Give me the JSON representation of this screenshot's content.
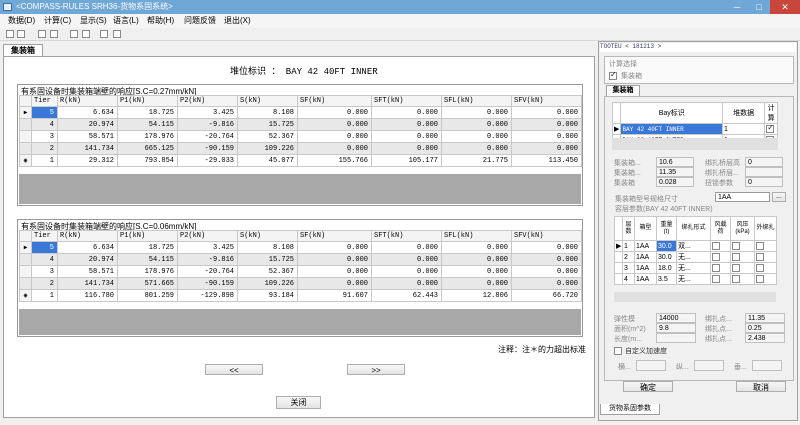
{
  "window": {
    "title": "<COMPASS-RULES SRH36-货物系固系统>"
  },
  "menu": [
    "数据(D)",
    "计算(C)",
    "显示(S)",
    "语言(L)",
    "帮助(H)",
    "问题反馈",
    "退出(X)"
  ],
  "tab_label": "集装箱",
  "stack_id": "堆位标识 ： BAY 42 40FT INNER",
  "grid1": {
    "caption": "有系固设备时集装箱端壁的响应[S.C=0.27mm/kN]",
    "headers": [
      "",
      "Tier",
      "R(kN)",
      "P1(kN)",
      "P2(kN)",
      "S(kN)",
      "SF(kN)",
      "SFT(kN)",
      "SFL(kN)",
      "SFV(kN)"
    ],
    "rows": [
      {
        "ind": "▶",
        "cells": [
          "5",
          "6.634",
          "18.725",
          "3.425",
          "8.108",
          "0.000",
          "0.000",
          "0.000",
          "0.000"
        ]
      },
      {
        "ind": "",
        "cells": [
          "4",
          "20.974",
          "54.115",
          "-9.816",
          "15.725",
          "0.000",
          "0.000",
          "0.000",
          "0.000"
        ]
      },
      {
        "ind": "",
        "cells": [
          "3",
          "58.571",
          "178.976",
          "-20.764",
          "52.367",
          "0.000",
          "0.000",
          "0.000",
          "0.000"
        ]
      },
      {
        "ind": "",
        "cells": [
          "2",
          "141.734",
          "665.125",
          "-90.159",
          "109.226",
          "0.000",
          "0.000",
          "0.000",
          "0.000"
        ]
      },
      {
        "ind": "◉",
        "cells": [
          "1",
          "29.312",
          "793.854",
          "-29.033",
          "45.077",
          "155.766",
          "105.177",
          "21.775",
          "113.450"
        ]
      }
    ]
  },
  "grid2": {
    "caption": "有系固设备时集装箱端壁的响应[S.C=0.06mm/kN]",
    "headers": [
      "",
      "Tier",
      "R(kN)",
      "P1(kN)",
      "P2(kN)",
      "S(kN)",
      "SF(kN)",
      "SFT(kN)",
      "SFL(kN)",
      "SFV(kN)"
    ],
    "rows": [
      {
        "ind": "▶",
        "cells": [
          "5",
          "6.634",
          "18.725",
          "3.425",
          "8.108",
          "0.000",
          "0.000",
          "0.000",
          "0.000"
        ]
      },
      {
        "ind": "",
        "cells": [
          "4",
          "20.974",
          "54.115",
          "-9.816",
          "15.725",
          "0.000",
          "0.000",
          "0.000",
          "0.000"
        ]
      },
      {
        "ind": "",
        "cells": [
          "3",
          "58.571",
          "178.976",
          "-20.764",
          "52.367",
          "0.000",
          "0.000",
          "0.000",
          "0.000"
        ]
      },
      {
        "ind": "",
        "cells": [
          "2",
          "141.734",
          "571.665",
          "-90.159",
          "109.226",
          "0.000",
          "0.000",
          "0.000",
          "0.000"
        ]
      },
      {
        "ind": "◉",
        "cells": [
          "1",
          "116.780",
          "801.259",
          "-129.898",
          "93.184",
          "91.607",
          "62.443",
          "12.806",
          "66.720"
        ]
      }
    ]
  },
  "note": "注释：注＊的力超出标准",
  "nav": {
    "prev": "<<",
    "next": ">>"
  },
  "close_label": "关闭",
  "right": {
    "header": "TOOTEU < 181213 >",
    "calc_select_label": "计算选择",
    "calc_container_label": "集装箱",
    "tab_label": "集装箱",
    "bay_headers": [
      "",
      "Bay标识",
      "堆数据",
      "计算"
    ],
    "bays": [
      {
        "ind": "▶",
        "id": "BAY 42 40FT INNER",
        "num": "1",
        "checked": true
      },
      {
        "ind": "",
        "id": "BAY 38 40FT OUTER",
        "num": "1",
        "checked": false
      }
    ],
    "fields_left": [
      {
        "label": "集装箱...",
        "value": "10.6"
      },
      {
        "label": "集装箱...",
        "value": "11.35"
      },
      {
        "label": "集装箱",
        "value": "0.028"
      }
    ],
    "fields_right": [
      {
        "label": "绑扎桥层高",
        "value": "0"
      },
      {
        "label": "绑扎桥层...",
        "value": ""
      },
      {
        "label": "扭锁参数",
        "value": "0"
      }
    ],
    "type_label": "集装箱型号规格尺寸",
    "type_value": "1AA",
    "layer_label": "容层参数(BAY 42 40FT INNER)",
    "tier_headers": [
      "",
      "层数",
      "箱型",
      "重量(t)",
      "绑扎形式",
      "风载荷",
      "风压(kPa)",
      "外绑扎"
    ],
    "tiers": [
      {
        "ind": "▶",
        "n": "1",
        "type": "1AA",
        "w": "30.0",
        "form": "双..."
      },
      {
        "ind": "",
        "n": "2",
        "type": "1AA",
        "w": "30.0",
        "form": "无..."
      },
      {
        "ind": "",
        "n": "3",
        "type": "1AA",
        "w": "18.0",
        "form": "无..."
      },
      {
        "ind": "",
        "n": "4",
        "type": "1AA",
        "w": "3.5",
        "form": "无..."
      }
    ],
    "bottom_fields_left": [
      {
        "label": "弹性模",
        "value": "14000"
      },
      {
        "label": "面积(m^2)",
        "value": "9.8"
      },
      {
        "label": "长度(m...",
        "value": ""
      }
    ],
    "bottom_fields_right": [
      {
        "label": "绑扎点...",
        "value": "11.35"
      },
      {
        "label": "绑扎点...",
        "value": "0.25"
      },
      {
        "label": "绑扎点...",
        "value": "2.438"
      }
    ],
    "custom_accel_label": "自定义加速度",
    "accel_labels": [
      "横...",
      "纵...",
      "垂..."
    ],
    "ok_label": "确定",
    "cancel_label": "取消",
    "bottom_tab": "货物系固参数"
  }
}
